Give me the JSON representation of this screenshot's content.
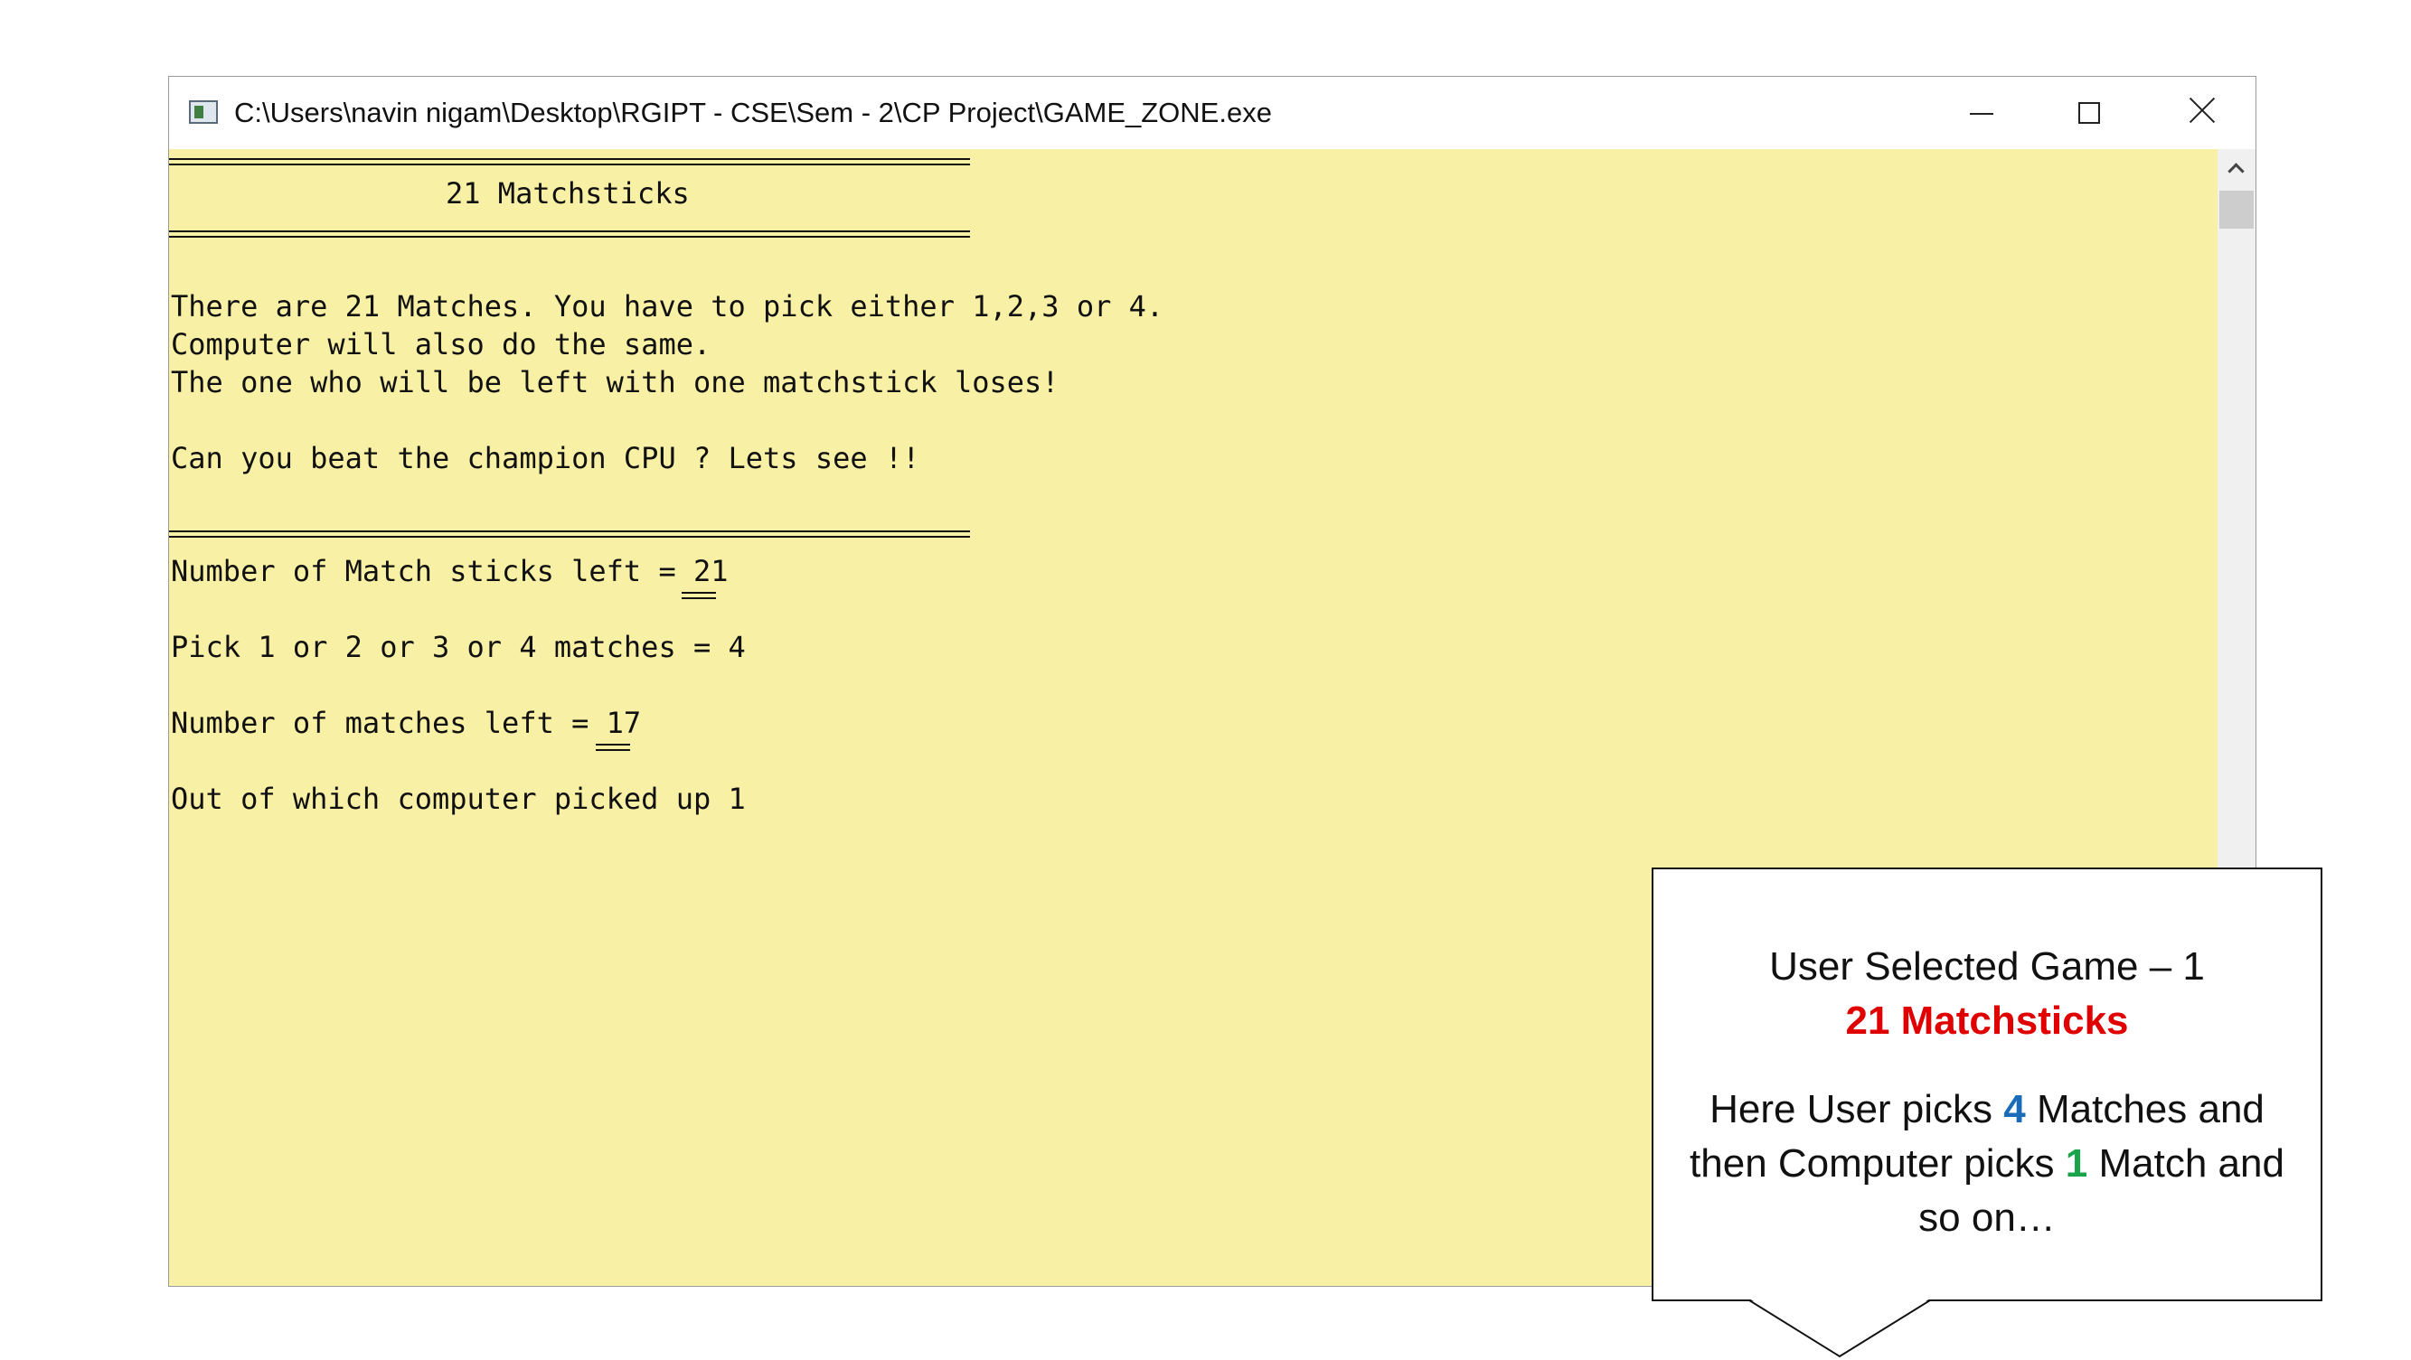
{
  "window": {
    "title": "C:\\Users\\navin nigam\\Desktop\\RGIPT - CSE\\Sem - 2\\CP Project\\GAME_ZONE.exe"
  },
  "console": {
    "heading": "21 Matchsticks",
    "rules_line1": "There are 21 Matches. You have to pick either 1,2,3 or 4.",
    "rules_line2": "Computer will also do the same.",
    "rules_line3": "The one who will be left with one matchstick loses!",
    "challenge": "Can you beat the champion CPU ? Lets see !!",
    "sticks_left_label": "Number of Match sticks left = ",
    "sticks_left_value": "21",
    "pick_prompt": "Pick 1 or 2 or 3 or 4 matches = 4",
    "matches_left_label": "Number of matches left = ",
    "matches_left_value": "17",
    "computer_pick": "Out of which computer picked up 1"
  },
  "callout": {
    "line1": "User Selected Game – 1",
    "line2": "21 Matchsticks",
    "line3_a": "Here User picks ",
    "line3_num": "4",
    "line3_b": " Matches and",
    "line4_a": "then Computer picks ",
    "line4_num": "1",
    "line4_b": " Match and",
    "line5": "so on…"
  },
  "colors": {
    "console_bg": "#f8f0a5",
    "highlight_red": "#e00000",
    "highlight_blue": "#1a6bb8",
    "highlight_green": "#1aa34a"
  },
  "icons": [
    "app-icon",
    "minimize-icon",
    "maximize-icon",
    "close-icon",
    "scroll-up-icon"
  ]
}
